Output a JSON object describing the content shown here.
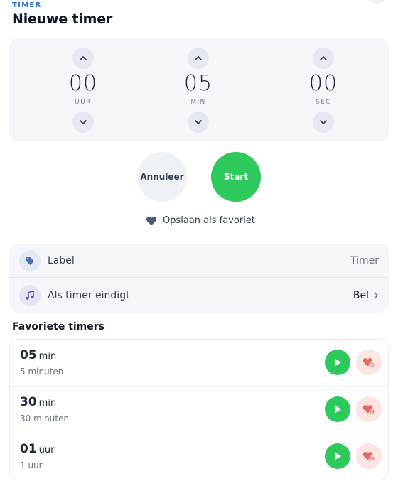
{
  "header": {
    "eyebrow": "TIMER",
    "title": "Nieuwe timer"
  },
  "picker": {
    "hours": {
      "value": "00",
      "unit": "UUR"
    },
    "minutes": {
      "value": "05",
      "unit": "MIN"
    },
    "seconds": {
      "value": "00",
      "unit": "SEC"
    }
  },
  "actions": {
    "cancel_label": "Annuleer",
    "start_label": "Start",
    "save_favorite_label": "Opslaan als favoriet"
  },
  "settings": {
    "label": {
      "title": "Label",
      "value": "Timer",
      "icon": "tag-icon"
    },
    "when_ends": {
      "title": "Als timer eindigt",
      "value": "Bel",
      "icon": "music-note-icon"
    }
  },
  "favorites": {
    "title": "Favoriete timers",
    "items": [
      {
        "amount": "05",
        "unit": "min",
        "description": "5 minuten"
      },
      {
        "amount": "30",
        "unit": "min",
        "description": "30 minuten"
      },
      {
        "amount": "01",
        "unit": "uur",
        "description": "1 uur"
      }
    ]
  },
  "colors": {
    "accent_green": "#2ec95c",
    "accent_blue": "#2f76d2",
    "remove_red": "#e8675a"
  }
}
